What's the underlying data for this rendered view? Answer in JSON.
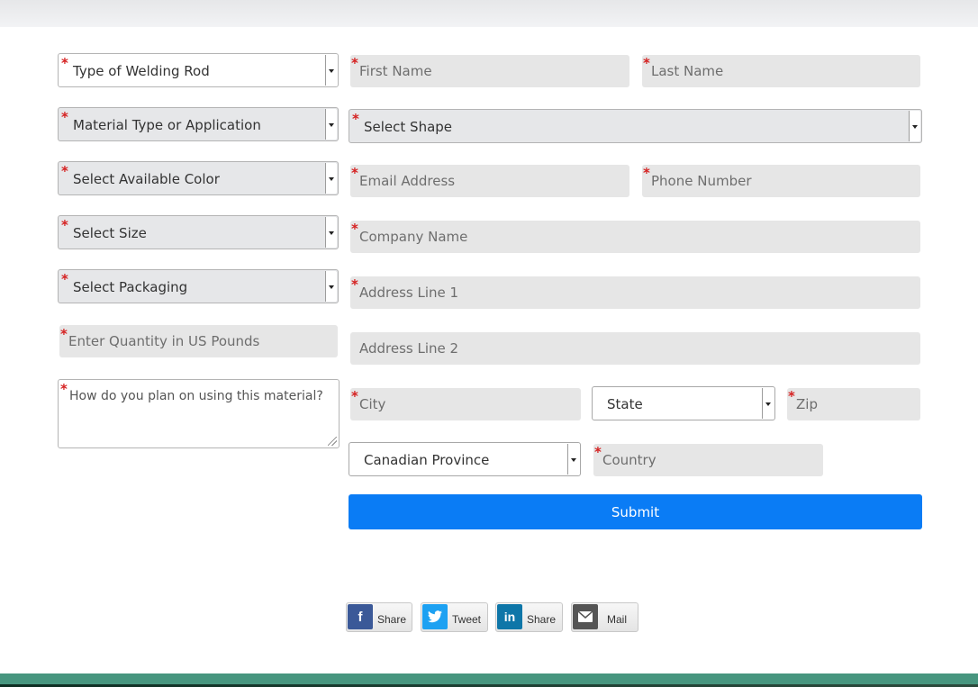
{
  "form": {
    "left_column": {
      "welding_rod": "Type of Welding Rod",
      "material": "Material Type or Application",
      "color": "Select Available Color",
      "size": "Select Size",
      "packaging": "Select Packaging",
      "quantity_placeholder": "Enter Quantity in US Pounds",
      "usage_placeholder": "How do you plan on using this material?"
    },
    "right_column": {
      "first_name": "First Name",
      "last_name": "Last Name",
      "shape": "Select Shape",
      "email": "Email Address",
      "phone": "Phone Number",
      "company": "Company Name",
      "address1": "Address Line 1",
      "address2": "Address Line 2",
      "city": "City",
      "state": "State",
      "zip": "Zip",
      "province": "Canadian Province",
      "country": "Country"
    },
    "required_marker": "*",
    "submit_label": "Submit"
  },
  "share_buttons": [
    {
      "icon": "facebook-icon",
      "glyph": "f",
      "label": "Share",
      "color": "#3b5998"
    },
    {
      "icon": "twitter-icon",
      "glyph": "🐦",
      "label": "Tweet",
      "color": "#1da1f2"
    },
    {
      "icon": "linkedin-icon",
      "glyph": "in",
      "label": "Share",
      "color": "#0e76a8"
    },
    {
      "icon": "mail-icon",
      "glyph": "✉",
      "label": "Mail",
      "color": "#555555"
    }
  ],
  "colors": {
    "submit": "#0a7cf5",
    "required": "#d52020",
    "field_bg": "#e6e6e6",
    "footer": "#47967f"
  }
}
